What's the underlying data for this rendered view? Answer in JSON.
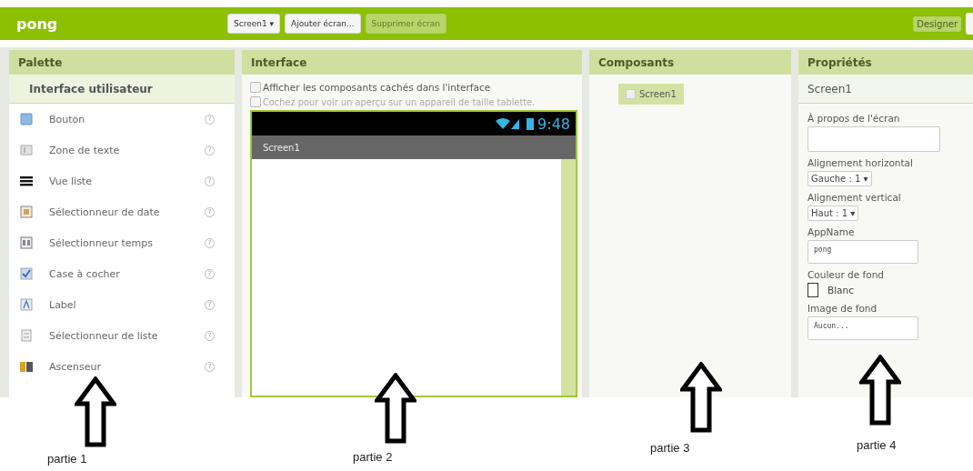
{
  "app_bar": {
    "project": "pong",
    "buttons": [
      {
        "label": "Screen1 ▾",
        "disabled": false
      },
      {
        "label": "Ajouter écran...",
        "disabled": false
      },
      {
        "label": "Supprimer écran",
        "disabled": true
      }
    ],
    "right_buttons": [
      {
        "label": "Designer",
        "selected": true
      }
    ]
  },
  "palette": {
    "title": "Palette",
    "group": "Interface utilisateur",
    "items": [
      {
        "label": "Bouton",
        "help": "?"
      },
      {
        "label": "Zone de texte",
        "help": "?"
      },
      {
        "label": "Vue liste",
        "help": "?"
      },
      {
        "label": "Sélectionneur de date",
        "help": "?"
      },
      {
        "label": "Sélectionneur temps",
        "help": "?"
      },
      {
        "label": "Case à cocher",
        "help": "?"
      },
      {
        "label": "Label",
        "help": "?"
      },
      {
        "label": "Sélectionneur de liste",
        "help": "?"
      },
      {
        "label": "Ascenseur",
        "help": "?"
      }
    ]
  },
  "viewer": {
    "title": "Interface",
    "options": [
      {
        "label": "Afficher les composants cachés dans l'interface",
        "checked": false,
        "disabled": false
      },
      {
        "label": "Cochez pour voir un aperçu sur un appareil de taille tablette.",
        "checked": false,
        "disabled": true
      }
    ],
    "phone": {
      "time": "9:48",
      "screen_title": "Screen1"
    }
  },
  "components": {
    "title": "Composants",
    "tree": [
      {
        "label": "Screen1",
        "selected": true
      }
    ]
  },
  "properties": {
    "title": "Propriétés",
    "component": "Screen1",
    "items": [
      {
        "kind": "textarea",
        "label": "À propos de l'écran"
      },
      {
        "kind": "select",
        "label": "Alignement horizontal",
        "value": "Gauche : 1 ▾"
      },
      {
        "kind": "select",
        "label": "Alignement vertical",
        "value": "Haut : 1 ▾"
      },
      {
        "kind": "input",
        "label": "AppName",
        "value": "pong"
      },
      {
        "kind": "color",
        "label": "Couleur de fond",
        "value": "Blanc",
        "color": "#ffffff"
      },
      {
        "kind": "input",
        "label": "Image de fond",
        "value": "Aucun..."
      }
    ]
  },
  "annotations": [
    {
      "label": "partie 1"
    },
    {
      "label": "partie 2"
    },
    {
      "label": "partie 3"
    },
    {
      "label": "partie 4"
    }
  ]
}
